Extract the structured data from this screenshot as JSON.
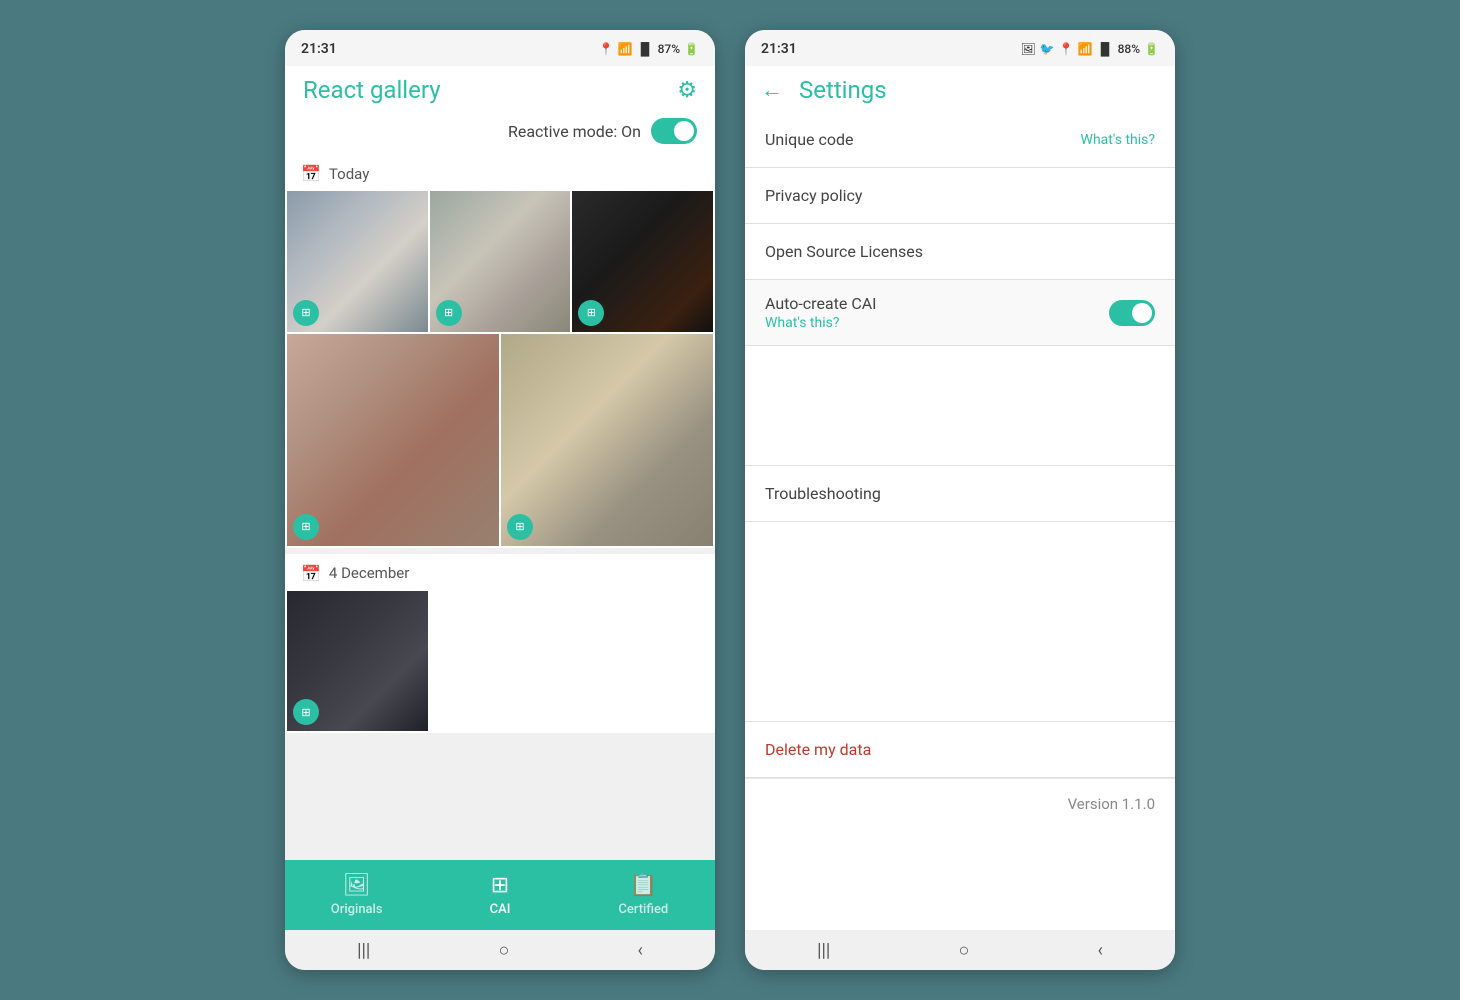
{
  "phone1": {
    "status_bar": {
      "time": "21:31",
      "battery": "87%",
      "icons": "📍 WiFi Signal"
    },
    "header": {
      "title": "React gallery",
      "gear_icon": "⚙"
    },
    "reactive_mode": {
      "label": "Reactive mode: On"
    },
    "sections": [
      {
        "date_label": "Today",
        "photos": [
          {
            "id": "p1",
            "style_class": "photo-1"
          },
          {
            "id": "p2",
            "style_class": "photo-2"
          },
          {
            "id": "p3",
            "style_class": "photo-3"
          },
          {
            "id": "p4",
            "style_class": "photo-4"
          },
          {
            "id": "p5",
            "style_class": "photo-5"
          }
        ]
      },
      {
        "date_label": "4 December",
        "photos": [
          {
            "id": "p6",
            "style_class": "photo-6"
          }
        ]
      }
    ],
    "bottom_nav": {
      "items": [
        {
          "label": "Originals",
          "icon": "🖼",
          "active": false
        },
        {
          "label": "CAI",
          "icon": "⊞",
          "active": true
        },
        {
          "label": "Certified",
          "icon": "📋",
          "active": false
        }
      ]
    },
    "system_bar": {
      "buttons": [
        "|||",
        "○",
        "‹"
      ]
    }
  },
  "phone2": {
    "status_bar": {
      "time": "21:31",
      "battery": "88%",
      "icons": "🖼 🐦 📍 WiFi Signal"
    },
    "header": {
      "back_icon": "←",
      "title": "Settings"
    },
    "settings_rows": [
      {
        "label": "Unique code",
        "action": "What's this?",
        "type": "link"
      },
      {
        "label": "Privacy policy",
        "type": "plain"
      },
      {
        "label": "Open Source Licenses",
        "type": "plain"
      },
      {
        "label": "Auto-create CAI",
        "action": "What's this?",
        "type": "toggle"
      },
      {
        "label": "Troubleshooting",
        "type": "plain"
      },
      {
        "label": "Delete my data",
        "type": "delete"
      }
    ],
    "version": {
      "label": "Version 1.1.0"
    },
    "system_bar": {
      "buttons": [
        "|||",
        "○",
        "‹"
      ]
    }
  }
}
